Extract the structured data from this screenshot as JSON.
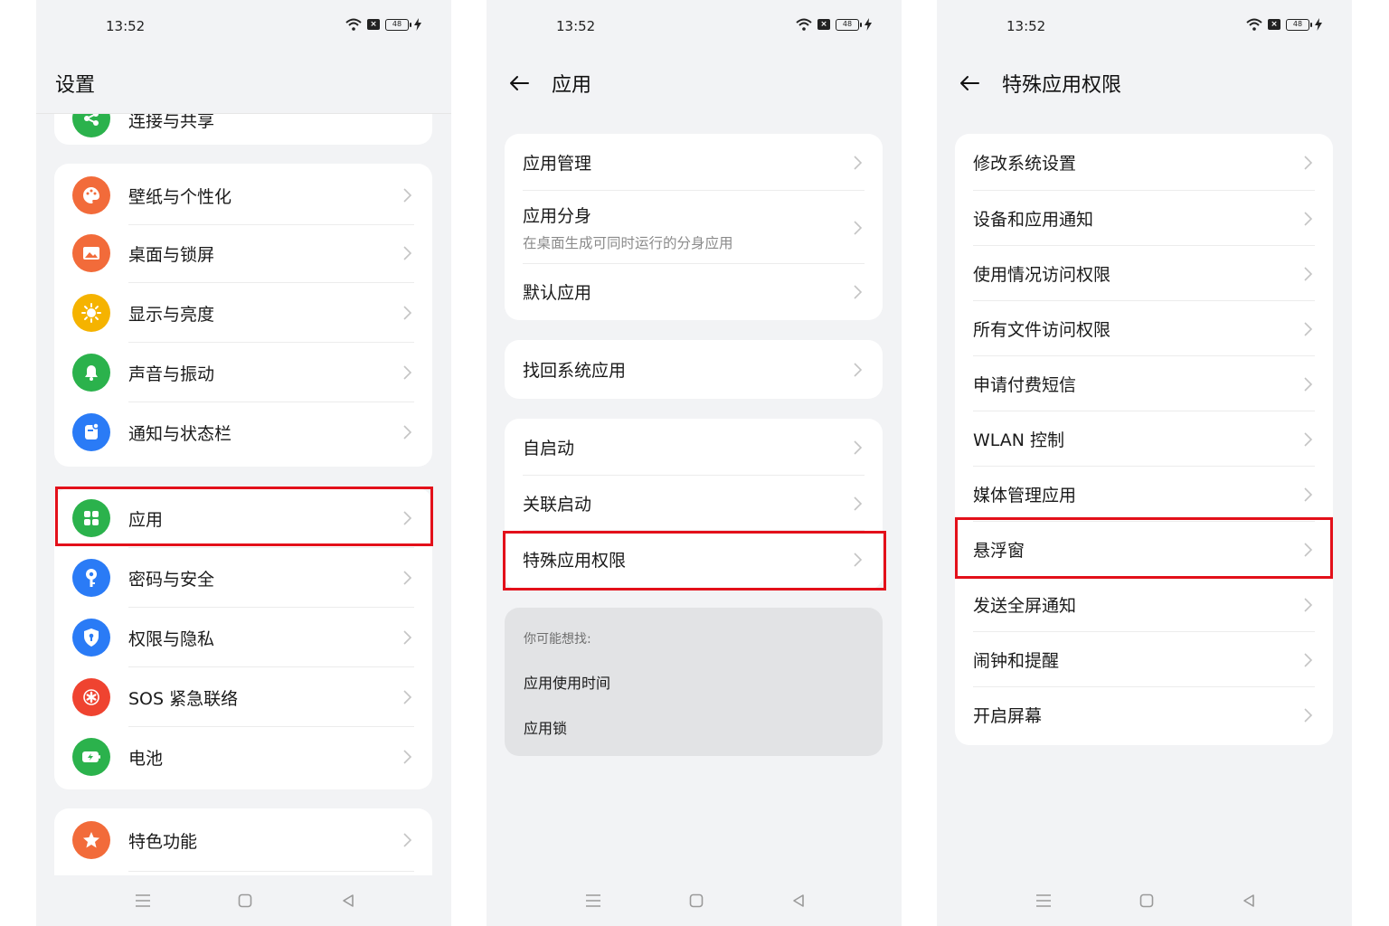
{
  "status": {
    "time": "13:52",
    "battery": "48"
  },
  "screen1": {
    "title": "设置",
    "partial_item": "连接与共享",
    "group1": [
      {
        "label": "壁纸与个性化",
        "icon": "palette-icon",
        "color": "#f26b3a"
      },
      {
        "label": "桌面与锁屏",
        "icon": "picture-icon",
        "color": "#f26b3a"
      },
      {
        "label": "显示与亮度",
        "icon": "sun-icon",
        "color": "#f5b300"
      },
      {
        "label": "声音与振动",
        "icon": "bell-icon",
        "color": "#2bb24c"
      },
      {
        "label": "通知与状态栏",
        "icon": "notification-icon",
        "color": "#2a7bf6"
      }
    ],
    "group2": [
      {
        "label": "应用",
        "icon": "apps-grid-icon",
        "color": "#2bb24c"
      },
      {
        "label": "密码与安全",
        "icon": "key-icon",
        "color": "#2a7bf6"
      },
      {
        "label": "权限与隐私",
        "icon": "shield-icon",
        "color": "#2a7bf6"
      },
      {
        "label": "SOS 紧急联络",
        "icon": "sos-asterisk-icon",
        "color": "#ef4330"
      },
      {
        "label": "电池",
        "icon": "battery-icon",
        "color": "#2bb24c"
      }
    ],
    "group3": [
      {
        "label": "特色功能",
        "icon": "star-icon",
        "color": "#f26b3a"
      }
    ]
  },
  "screen2": {
    "title": "应用",
    "group1": [
      {
        "label": "应用管理"
      },
      {
        "label": "应用分身",
        "sub": "在桌面生成可同时运行的分身应用"
      },
      {
        "label": "默认应用"
      }
    ],
    "group2": [
      {
        "label": "找回系统应用"
      }
    ],
    "group3": [
      {
        "label": "自启动"
      },
      {
        "label": "关联启动"
      },
      {
        "label": "特殊应用权限"
      }
    ],
    "suggest": {
      "hint": "你可能想找:",
      "links": [
        "应用使用时间",
        "应用锁"
      ]
    }
  },
  "screen3": {
    "title": "特殊应用权限",
    "items": [
      "修改系统设置",
      "设备和应用通知",
      "使用情况访问权限",
      "所有文件访问权限",
      "申请付费短信",
      "WLAN 控制",
      "媒体管理应用",
      "悬浮窗",
      "发送全屏通知",
      "闹钟和提醒",
      "开启屏幕"
    ]
  },
  "highlight_color": "#e3101a"
}
